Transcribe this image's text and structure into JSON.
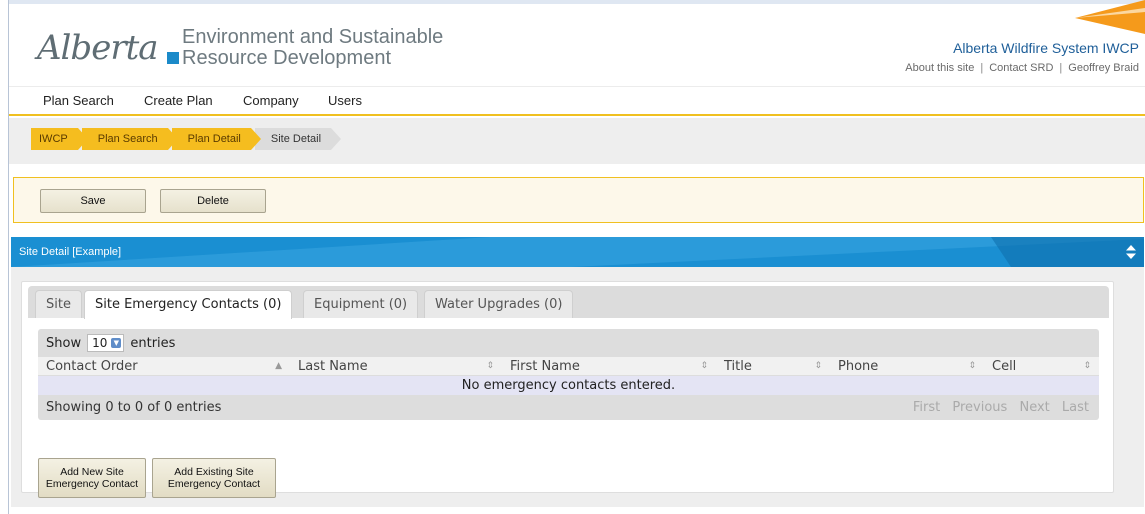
{
  "header": {
    "logo_text": "Alberta",
    "department_line1": "Environment and Sustainable",
    "department_line2": "Resource Development",
    "system_title": "Alberta Wildfire System IWCP",
    "links": [
      "About this site",
      "Contact SRD",
      "Geoffrey Braid"
    ]
  },
  "nav": {
    "items": [
      "Plan Search",
      "Create Plan",
      "Company",
      "Users"
    ]
  },
  "breadcrumb": {
    "items": [
      "IWCP",
      "Plan Search",
      "Plan Detail",
      "Site Detail"
    ]
  },
  "toolbar": {
    "save_label": "Save",
    "delete_label": "Delete"
  },
  "panel": {
    "title": "Site Detail [Example]"
  },
  "tabs": [
    {
      "label": "Site",
      "active": false
    },
    {
      "label": "Site Emergency Contacts (0)",
      "active": true
    },
    {
      "label": "Equipment (0)",
      "active": false
    },
    {
      "label": "Water Upgrades (0)",
      "active": false
    }
  ],
  "table": {
    "show_label": "Show",
    "page_size": "10",
    "entries_label": "entries",
    "columns": [
      "Contact Order",
      "Last Name",
      "First Name",
      "Title",
      "Phone",
      "Cell"
    ],
    "empty_message": "No emergency contacts entered.",
    "info": "Showing 0 to 0 of 0 entries",
    "pager": [
      "First",
      "Previous",
      "Next",
      "Last"
    ]
  },
  "actions": {
    "add_new_line1": "Add New Site",
    "add_new_line2": "Emergency Contact",
    "add_existing_line1": "Add Existing Site",
    "add_existing_line2": "Emergency Contact"
  },
  "colors": {
    "accent_blue": "#1a8fd2",
    "crumb_yellow": "#f5bd1f",
    "orange": "#f59a1b"
  }
}
